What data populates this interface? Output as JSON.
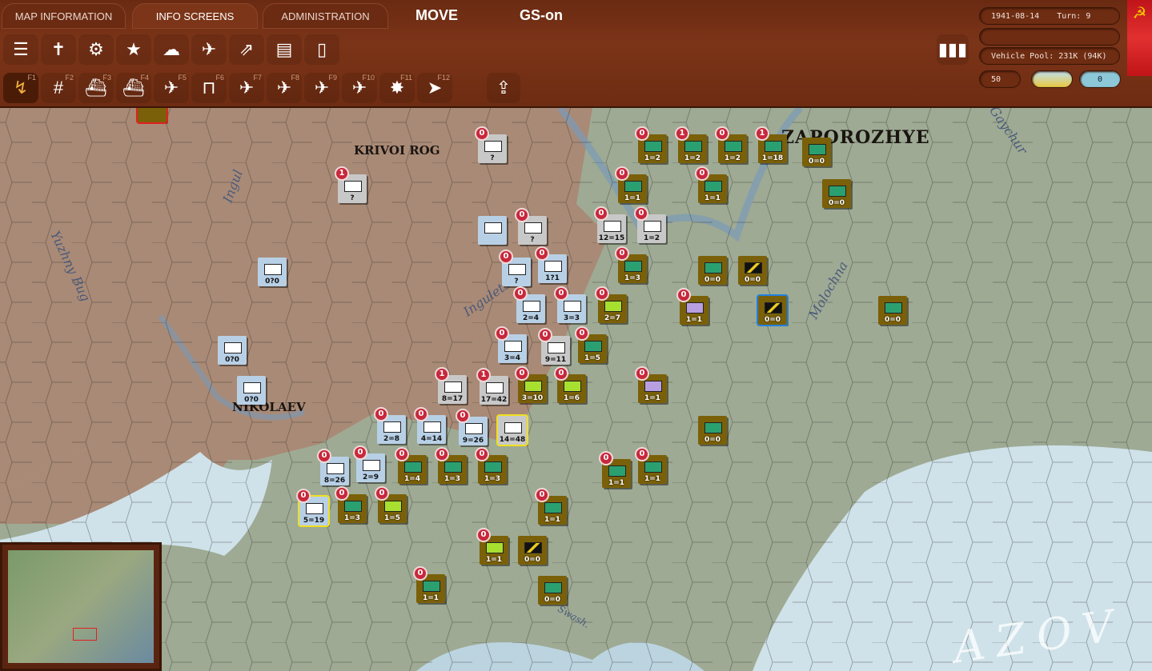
{
  "tabs": [
    "MAP INFORMATION",
    "INFO SCREENS",
    "ADMINISTRATION"
  ],
  "mode": "MOVE",
  "gs": "GS-on",
  "toolbar1": [
    "tank-list-icon",
    "graves-icon",
    "gear-icon",
    "star-icon",
    "weather-icon",
    "air-battle-icon",
    "air-missions-icon",
    "reports-icon",
    "notes-icon"
  ],
  "toolbar2": [
    {
      "icon": "move-icon",
      "key": "F1"
    },
    {
      "icon": "rail-icon",
      "key": "F2"
    },
    {
      "icon": "naval-transport-icon",
      "key": "F3"
    },
    {
      "icon": "naval-icon",
      "key": "F4"
    },
    {
      "icon": "air-recon-icon",
      "key": "F5"
    },
    {
      "icon": "air-base-icon",
      "key": "F6"
    },
    {
      "icon": "air-strike-icon",
      "key": "F7"
    },
    {
      "icon": "bomb-city-icon",
      "key": "F8"
    },
    {
      "icon": "paradrop-icon",
      "key": "F9"
    },
    {
      "icon": "air-transfer-icon",
      "key": "F10"
    },
    {
      "icon": "attack-icon",
      "key": "F11"
    },
    {
      "icon": "end-turn-icon",
      "key": "F12"
    }
  ],
  "status": {
    "date": "1941-08-14",
    "turn": "Turn: 9",
    "vehicle_pool": "Vehicle Pool: 231K (94K)",
    "value": "50",
    "weather_value": "0"
  },
  "colors": {
    "bar": "#7b3418",
    "soviet": "#b8d0e6",
    "axis": "#7a6008",
    "flag": "#d42020"
  },
  "map": {
    "cities": [
      "KRIVOI ROG",
      "NIKOLAEV",
      "ZAPOROZHYE"
    ],
    "rivers": [
      "Ingul",
      "Yuzhny Bug",
      "Ingulets",
      "Molochna",
      "Gaychur",
      "Swash."
    ],
    "sea": "AZOV S"
  },
  "units": [
    {
      "s": "?",
      "b": "0",
      "c": "gray"
    },
    {
      "s": "?",
      "b": "1",
      "c": "gray"
    },
    {
      "s": "",
      "b": "",
      "c": "blue"
    },
    {
      "s": "?",
      "b": "0",
      "c": "gray"
    },
    {
      "s": "?",
      "b": "0",
      "c": "blue"
    },
    {
      "s": "1?1",
      "b": "0",
      "c": "blue"
    },
    {
      "s": "0?0",
      "b": "",
      "c": "blue"
    },
    {
      "s": "0?0",
      "b": "",
      "c": "blue"
    },
    {
      "s": "0?0",
      "b": "",
      "c": "blue"
    },
    {
      "s": "2=4",
      "b": "0",
      "c": "blue"
    },
    {
      "s": "3=3",
      "b": "0",
      "c": "blue"
    },
    {
      "s": "3=4",
      "b": "0",
      "c": "blue"
    },
    {
      "s": "9=11",
      "b": "0",
      "c": "gray"
    },
    {
      "s": "8=17",
      "b": "1",
      "c": "gray"
    },
    {
      "s": "17=42",
      "b": "1",
      "c": "gray"
    },
    {
      "s": "2=8",
      "b": "0",
      "c": "blue"
    },
    {
      "s": "4=14",
      "b": "0",
      "c": "blue"
    },
    {
      "s": "9=26",
      "b": "0",
      "c": "blue"
    },
    {
      "s": "14=48",
      "b": "",
      "c": "gray"
    },
    {
      "s": "8=26",
      "b": "0",
      "c": "blue"
    },
    {
      "s": "2=9",
      "b": "0",
      "c": "blue"
    },
    {
      "s": "5=19",
      "b": "0",
      "c": "blue"
    },
    {
      "s": "12=15",
      "b": "0",
      "c": "gray"
    },
    {
      "s": "1=2",
      "b": "0",
      "c": "gray"
    },
    {
      "s": "1=2",
      "b": "0",
      "c": "olive"
    },
    {
      "s": "1=2",
      "b": "1",
      "c": "olive"
    },
    {
      "s": "1=2",
      "b": "0",
      "c": "olive"
    },
    {
      "s": "1=18",
      "b": "1",
      "c": "olive"
    },
    {
      "s": "0=0",
      "b": "",
      "c": "olive"
    },
    {
      "s": "0=0",
      "b": "",
      "c": "olive"
    },
    {
      "s": "1=1",
      "b": "0",
      "c": "olive"
    },
    {
      "s": "1=1",
      "b": "0",
      "c": "olive"
    },
    {
      "s": "1=3",
      "b": "0",
      "c": "olive"
    },
    {
      "s": "0=0",
      "b": "",
      "c": "olive"
    },
    {
      "s": "0=0",
      "b": "",
      "c": "rom"
    },
    {
      "s": "2=7",
      "b": "0",
      "c": "lime"
    },
    {
      "s": "1=1",
      "b": "0",
      "c": "purple"
    },
    {
      "s": "0=0",
      "b": "",
      "c": "rom"
    },
    {
      "s": "0=0",
      "b": "",
      "c": "olive"
    },
    {
      "s": "1=5",
      "b": "0",
      "c": "olive"
    },
    {
      "s": "3=10",
      "b": "0",
      "c": "lime"
    },
    {
      "s": "1=6",
      "b": "0",
      "c": "lime"
    },
    {
      "s": "1=1",
      "b": "0",
      "c": "purple"
    },
    {
      "s": "0=0",
      "b": "",
      "c": "olive"
    },
    {
      "s": "1=4",
      "b": "0",
      "c": "olive"
    },
    {
      "s": "1=3",
      "b": "0",
      "c": "olive"
    },
    {
      "s": "1=3",
      "b": "0",
      "c": "olive"
    },
    {
      "s": "1=1",
      "b": "0",
      "c": "olive"
    },
    {
      "s": "1=1",
      "b": "0",
      "c": "olive"
    },
    {
      "s": "1=3",
      "b": "0",
      "c": "olive"
    },
    {
      "s": "1=5",
      "b": "0",
      "c": "lime"
    },
    {
      "s": "1=1",
      "b": "0",
      "c": "olive"
    },
    {
      "s": "1=1",
      "b": "0",
      "c": "lime"
    },
    {
      "s": "0=0",
      "b": "",
      "c": "rom"
    },
    {
      "s": "1=1",
      "b": "0",
      "c": "olive"
    },
    {
      "s": "0=0",
      "b": "",
      "c": "olive"
    }
  ]
}
